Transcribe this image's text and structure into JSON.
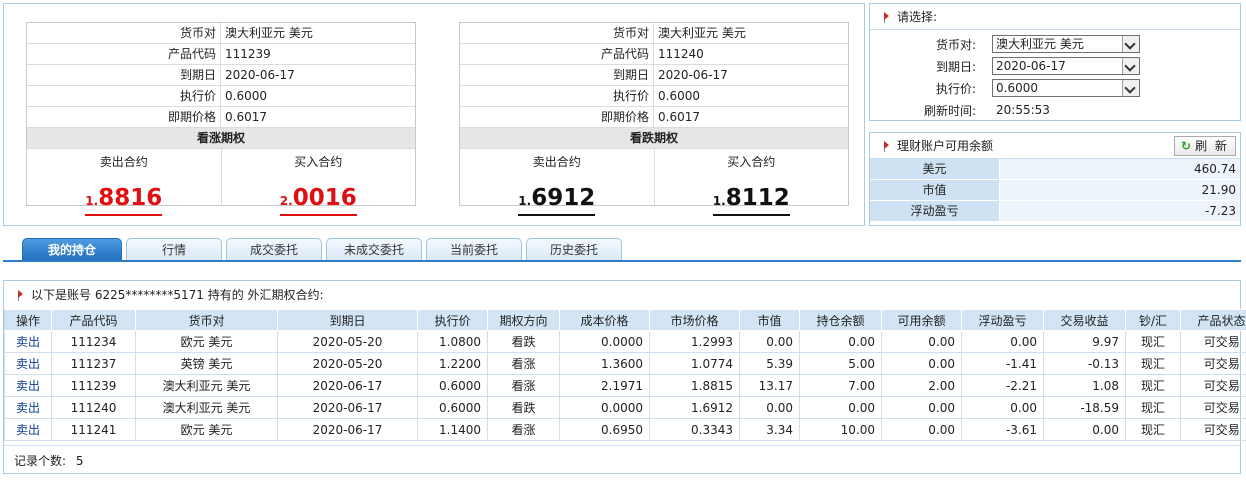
{
  "quotes": [
    {
      "rows": [
        {
          "label": "货币对",
          "value": "澳大利亚元 美元"
        },
        {
          "label": "产品代码",
          "value": "111239"
        },
        {
          "label": "到期日",
          "value": "2020-06-17"
        },
        {
          "label": "执行价",
          "value": "0.6000"
        },
        {
          "label": "即期价格",
          "value": "0.6017"
        }
      ],
      "option_type": "看涨期权",
      "sell_label": "卖出合约",
      "sell_small": "1.",
      "sell_big": "8816",
      "buy_label": "买入合约",
      "buy_small": "2.",
      "buy_big": "0016",
      "price_color": "#e01010"
    },
    {
      "rows": [
        {
          "label": "货币对",
          "value": "澳大利亚元 美元"
        },
        {
          "label": "产品代码",
          "value": "111240"
        },
        {
          "label": "到期日",
          "value": "2020-06-17"
        },
        {
          "label": "执行价",
          "value": "0.6000"
        },
        {
          "label": "即期价格",
          "value": "0.6017"
        }
      ],
      "option_type": "看跌期权",
      "sell_label": "卖出合约",
      "sell_small": "1.",
      "sell_big": "6912",
      "buy_label": "买入合约",
      "buy_small": "1.",
      "buy_big": "8112",
      "price_color": "#111111"
    }
  ],
  "select_panel": {
    "title": "请选择:",
    "currency_label": "货币对:",
    "currency_value": "澳大利亚元 美元",
    "expiry_label": "到期日:",
    "expiry_value": "2020-06-17",
    "strike_label": "执行价:",
    "strike_value": "0.6000",
    "refresh_time_label": "刷新时间:",
    "refresh_time_value": "20:55:53"
  },
  "account_panel": {
    "title": "理财账户可用余额",
    "refresh_button": "刷 新",
    "rows": [
      {
        "label": "美元",
        "value": "460.74"
      },
      {
        "label": "市值",
        "value": "21.90"
      },
      {
        "label": "浮动盈亏",
        "value": "-7.23"
      }
    ]
  },
  "tabs": [
    "我的持仓",
    "行情",
    "成交委托",
    "未成交委托",
    "当前委托",
    "历史委托"
  ],
  "positions": {
    "title": "以下是账号 6225********5171 持有的 外汇期权合约:",
    "columns": [
      "操作",
      "产品代码",
      "货币对",
      "到期日",
      "执行价",
      "期权方向",
      "成本价格",
      "市场价格",
      "市值",
      "持仓余额",
      "可用余额",
      "浮动盈亏",
      "交易收益",
      "钞/汇",
      "产品状态"
    ],
    "rows": [
      [
        "卖出",
        "111234",
        "欧元 美元",
        "2020-05-20",
        "1.0800",
        "看跌",
        "0.0000",
        "1.2993",
        "0.00",
        "0.00",
        "0.00",
        "0.00",
        "9.97",
        "现汇",
        "可交易"
      ],
      [
        "卖出",
        "111237",
        "英镑 美元",
        "2020-05-20",
        "1.2200",
        "看涨",
        "1.3600",
        "1.0774",
        "5.39",
        "5.00",
        "0.00",
        "-1.41",
        "-0.13",
        "现汇",
        "可交易"
      ],
      [
        "卖出",
        "111239",
        "澳大利亚元 美元",
        "2020-06-17",
        "0.6000",
        "看涨",
        "2.1971",
        "1.8815",
        "13.17",
        "7.00",
        "2.00",
        "-2.21",
        "1.08",
        "现汇",
        "可交易"
      ],
      [
        "卖出",
        "111240",
        "澳大利亚元 美元",
        "2020-06-17",
        "0.6000",
        "看跌",
        "0.0000",
        "1.6912",
        "0.00",
        "0.00",
        "0.00",
        "0.00",
        "-18.59",
        "现汇",
        "可交易"
      ],
      [
        "卖出",
        "111241",
        "欧元 美元",
        "2020-06-17",
        "1.1400",
        "看涨",
        "0.6950",
        "0.3343",
        "3.34",
        "10.00",
        "0.00",
        "-3.61",
        "0.00",
        "现汇",
        "可交易"
      ]
    ],
    "record_count_label": "记录个数:",
    "record_count": "5"
  }
}
